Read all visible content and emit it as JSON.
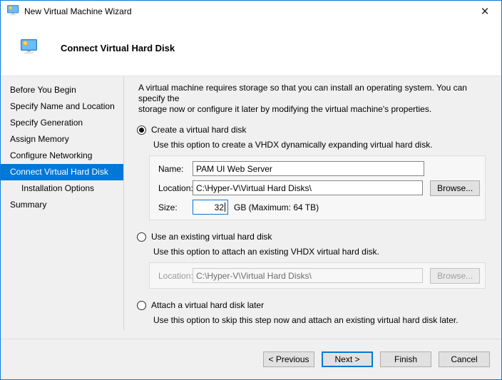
{
  "window": {
    "title": "New Virtual Machine Wizard",
    "close_glyph": "×"
  },
  "header": {
    "title": "Connect Virtual Hard Disk"
  },
  "sidebar": {
    "items": [
      {
        "label": "Before You Begin",
        "selected": false,
        "indent": false
      },
      {
        "label": "Specify Name and Location",
        "selected": false,
        "indent": false
      },
      {
        "label": "Specify Generation",
        "selected": false,
        "indent": false
      },
      {
        "label": "Assign Memory",
        "selected": false,
        "indent": false
      },
      {
        "label": "Configure Networking",
        "selected": false,
        "indent": false
      },
      {
        "label": "Connect Virtual Hard Disk",
        "selected": true,
        "indent": false
      },
      {
        "label": "Installation Options",
        "selected": false,
        "indent": true
      },
      {
        "label": "Summary",
        "selected": false,
        "indent": false
      }
    ]
  },
  "main": {
    "intro_line1": "A virtual machine requires storage so that you can install an operating system. You can specify the",
    "intro_line2": "storage now or configure it later by modifying the virtual machine's properties.",
    "create": {
      "label": "Create a virtual hard disk",
      "desc": "Use this option to create a VHDX dynamically expanding virtual hard disk.",
      "name_label": "Name:",
      "name_value": "PAM UI Web Server",
      "location_label": "Location:",
      "location_value": "C:\\Hyper-V\\Virtual Hard Disks\\",
      "size_label": "Size:",
      "size_value": "32",
      "size_suffix": "GB (Maximum: 64 TB)",
      "browse_label": "Browse..."
    },
    "existing": {
      "label": "Use an existing virtual hard disk",
      "desc": "Use this option to attach an existing VHDX virtual hard disk.",
      "location_label": "Location:",
      "location_value": "C:\\Hyper-V\\Virtual Hard Disks\\",
      "browse_label": "Browse..."
    },
    "later": {
      "label": "Attach a virtual hard disk later",
      "desc": "Use this option to skip this step now and attach an existing virtual hard disk later."
    }
  },
  "footer": {
    "previous_label": "< Previous",
    "next_label": "Next >",
    "finish_label": "Finish",
    "cancel_label": "Cancel"
  },
  "colors": {
    "accent": "#0078d7",
    "window_border": "#0b7bd8",
    "button_face": "#e1e1e1"
  }
}
